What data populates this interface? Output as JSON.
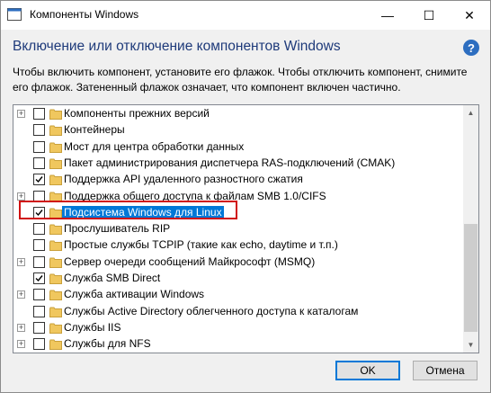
{
  "window": {
    "title": "Компоненты Windows",
    "minimize_glyph": "—",
    "maximize_glyph": "☐",
    "close_glyph": "✕"
  },
  "header": {
    "heading": "Включение или отключение компонентов Windows",
    "help_glyph": "?",
    "description": "Чтобы включить компонент, установите его флажок. Чтобы отключить компонент, снимите его флажок. Затененный флажок означает, что компонент включен частично."
  },
  "features": [
    {
      "label": "Компоненты прежних версий",
      "expandable": true,
      "checked": false
    },
    {
      "label": "Контейнеры",
      "expandable": false,
      "checked": false
    },
    {
      "label": "Мост для центра обработки данных",
      "expandable": false,
      "checked": false
    },
    {
      "label": "Пакет администрирования диспетчера RAS-подключений (CMAK)",
      "expandable": false,
      "checked": false
    },
    {
      "label": "Поддержка API удаленного разностного сжатия",
      "expandable": false,
      "checked": true
    },
    {
      "label": "Поддержка общего доступа к файлам SMB 1.0/CIFS",
      "expandable": true,
      "checked": false
    },
    {
      "label": "Подсистема Windows для Linux",
      "expandable": false,
      "checked": true,
      "selected": true
    },
    {
      "label": "Прослушиватель RIP",
      "expandable": false,
      "checked": false
    },
    {
      "label": "Простые службы TCPIP (такие как echo, daytime и т.п.)",
      "expandable": false,
      "checked": false
    },
    {
      "label": "Сервер очереди сообщений Майкрософт (MSMQ)",
      "expandable": true,
      "checked": false
    },
    {
      "label": "Служба SMB Direct",
      "expandable": false,
      "checked": true
    },
    {
      "label": "Служба активации Windows",
      "expandable": true,
      "checked": false
    },
    {
      "label": "Службы Active Directory облегченного доступа к каталогам",
      "expandable": false,
      "checked": false
    },
    {
      "label": "Службы IIS",
      "expandable": true,
      "checked": false
    },
    {
      "label": "Службы для NFS",
      "expandable": true,
      "checked": false
    },
    {
      "label": "",
      "expandable": true,
      "checked": false
    }
  ],
  "scrollbar": {
    "up_glyph": "▲",
    "down_glyph": "▼"
  },
  "buttons": {
    "ok": "OK",
    "cancel": "Отмена"
  },
  "colors": {
    "selection": "#0078d7",
    "heading": "#1e3a7a",
    "annotation_box": "#d01010",
    "folder": "#f0c75e"
  }
}
